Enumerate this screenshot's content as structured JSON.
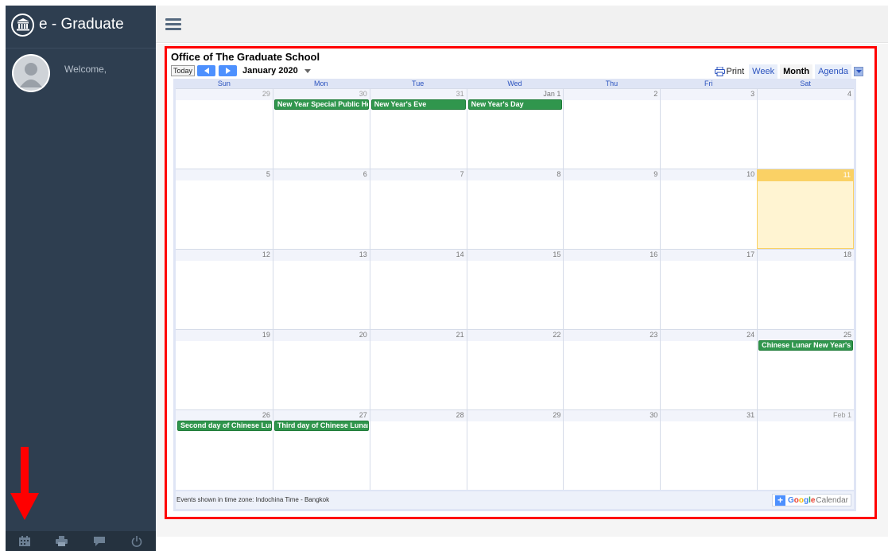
{
  "app": {
    "title": "e - Graduate"
  },
  "sidebar": {
    "welcome_text": "Welcome,",
    "footer_icons": [
      "calendar-icon",
      "print-icon",
      "chat-icon",
      "power-icon"
    ]
  },
  "colors": {
    "sidebar": "#2e3e50",
    "event": "#30964d",
    "highlight": "#ff0000",
    "today": "#fad165",
    "accent": "#4d90fe"
  },
  "calendar": {
    "title": "Office of The Graduate School",
    "today_label": "Today",
    "month_label": "January 2020",
    "print_label": "Print",
    "views": [
      {
        "label": "Week",
        "active": false
      },
      {
        "label": "Month",
        "active": true
      },
      {
        "label": "Agenda",
        "active": false
      }
    ],
    "day_names": [
      "Sun",
      "Mon",
      "Tue",
      "Wed",
      "Thu",
      "Fri",
      "Sat"
    ],
    "weeks": [
      [
        "29",
        "30",
        "31",
        "Jan 1",
        "2",
        "3",
        "4"
      ],
      [
        "5",
        "6",
        "7",
        "8",
        "9",
        "10",
        "11"
      ],
      [
        "12",
        "13",
        "14",
        "15",
        "16",
        "17",
        "18"
      ],
      [
        "19",
        "20",
        "21",
        "22",
        "23",
        "24",
        "25"
      ],
      [
        "26",
        "27",
        "28",
        "29",
        "30",
        "31",
        "Feb 1"
      ]
    ],
    "events": [
      {
        "week": 0,
        "day": 1,
        "title": "New Year Special Public Holiday"
      },
      {
        "week": 0,
        "day": 2,
        "title": "New Year's Eve"
      },
      {
        "week": 0,
        "day": 3,
        "title": "New Year's Day"
      },
      {
        "week": 3,
        "day": 6,
        "title": "Chinese Lunar New Year's Day"
      },
      {
        "week": 4,
        "day": 0,
        "title": "Second day of Chinese Lunar New Year"
      },
      {
        "week": 4,
        "day": 1,
        "title": "Third day of Chinese Lunar New Year"
      }
    ],
    "today_cell": {
      "week": 1,
      "day": 6
    },
    "timezone_text": "Events shown in time zone: Indochina Time - Bangkok",
    "gcal_google": "Google",
    "gcal_calendar": "Calendar"
  }
}
